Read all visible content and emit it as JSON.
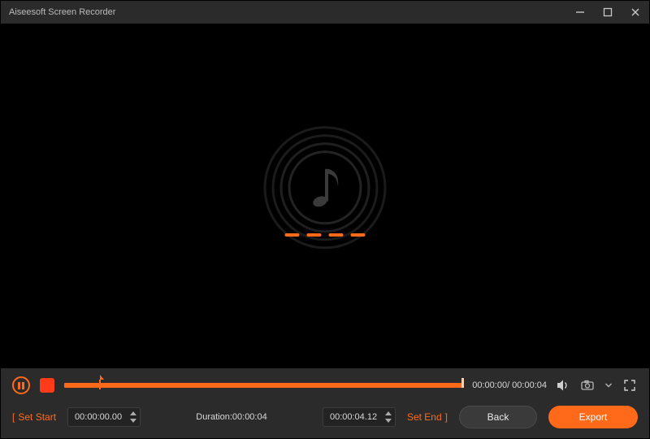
{
  "titlebar": {
    "app_name": "Aiseesoft Screen Recorder"
  },
  "controls": {
    "current_time": "00:00:00",
    "total_time": "00:00:04",
    "time_display": "00:00:00/ 00:00:04",
    "progress_start_pct": 8,
    "progress_end_pct": 100
  },
  "clip": {
    "set_start_label": "Set Start",
    "start_value": "00:00:00.00",
    "duration_label": "Duration:00:00:04",
    "end_value": "00:00:04.12",
    "set_end_label": "Set End"
  },
  "buttons": {
    "back": "Back",
    "export": "Export"
  },
  "icons": {
    "pause": "pause-icon",
    "stop": "stop-icon",
    "volume": "volume-icon",
    "camera": "camera-icon",
    "expand": "expand-icon",
    "minimize": "minimize-icon",
    "maximize": "maximize-icon",
    "close": "close-icon",
    "music_note": "music-note-icon",
    "chevron_down": "chevron-down-icon"
  },
  "colors": {
    "accent": "#ff6a1a",
    "bg": "#2b2b2b",
    "preview_bg": "#000000",
    "text": "#d8d8d8"
  }
}
